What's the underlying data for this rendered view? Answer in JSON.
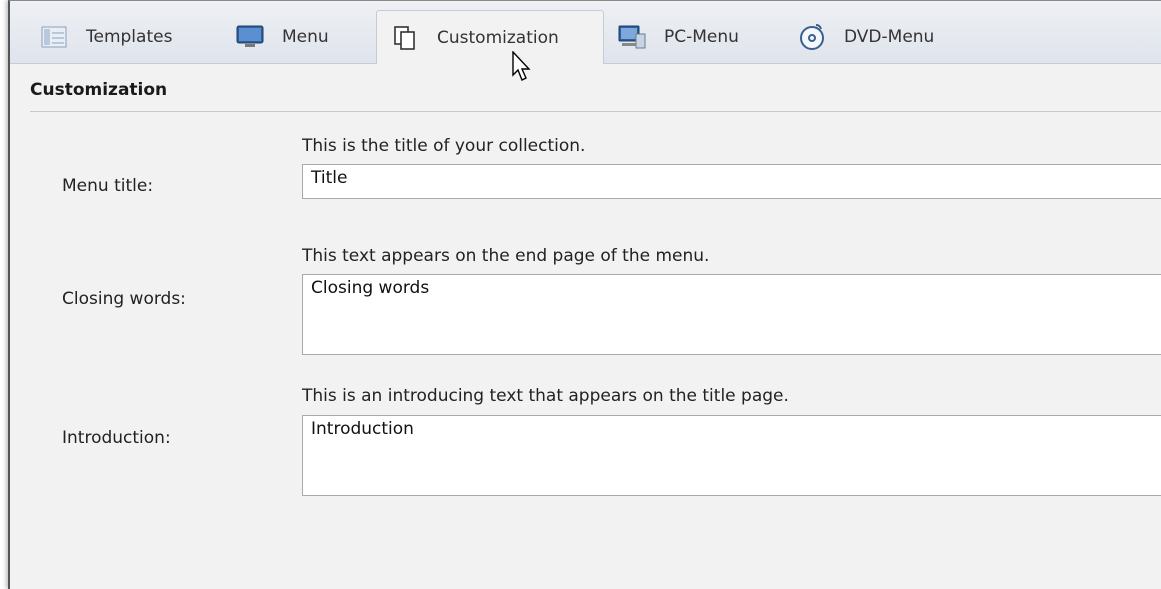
{
  "tabs": [
    {
      "label": "Templates",
      "icon": "templates-icon",
      "active": false
    },
    {
      "label": "Menu",
      "icon": "monitor-icon",
      "active": false
    },
    {
      "label": "Customization",
      "icon": "pages-icon",
      "active": true
    },
    {
      "label": "PC-Menu",
      "icon": "pc-icon",
      "active": false
    },
    {
      "label": "DVD-Menu",
      "icon": "dvd-icon",
      "active": false
    }
  ],
  "section": {
    "title": "Customization"
  },
  "fields": {
    "menu_title": {
      "label": "Menu title:",
      "hint": "This is the title of your collection.",
      "value": "Title"
    },
    "closing_words": {
      "label": "Closing words:",
      "hint": "This text appears on the end page of the menu.",
      "value": "Closing words"
    },
    "introduction": {
      "label": "Introduction:",
      "hint": "This is an introducing text that appears on the title page.",
      "value": "Introduction"
    }
  },
  "colors": {
    "tabbar": "#dfe4ec",
    "panel": "#f2f2f2",
    "accent": "#3a78c2"
  }
}
